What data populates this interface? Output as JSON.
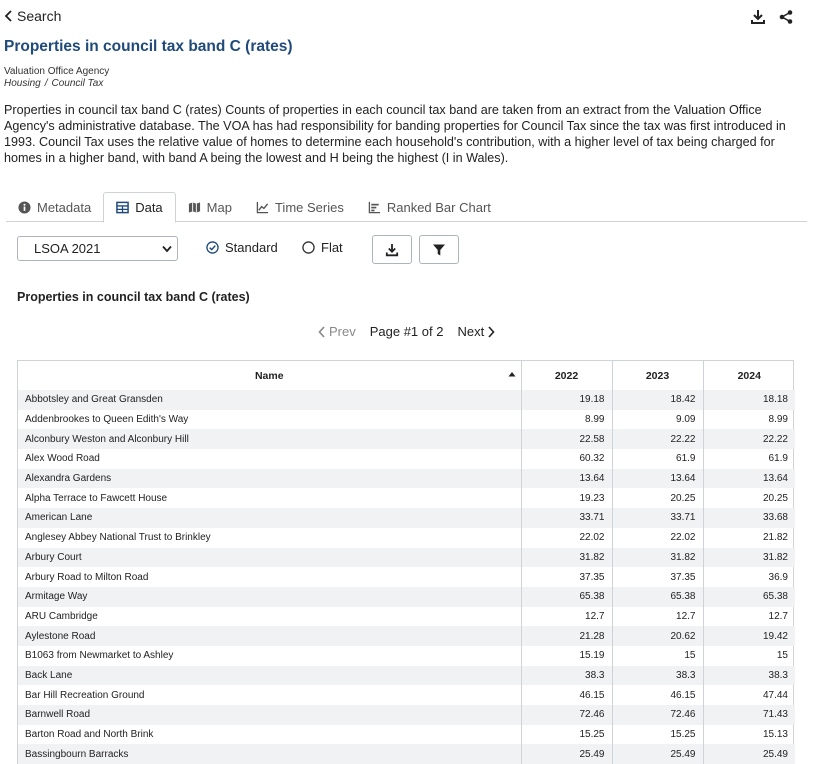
{
  "header": {
    "back_label": "Search",
    "title": "Properties in council tax band C (rates)",
    "publisher": "Valuation Office Agency",
    "breadcrumbs": [
      "Housing",
      "Council Tax"
    ],
    "description": "Properties in council tax band C (rates) Counts of properties in each council tax band are taken from an extract from the Valuation Office Agency's administrative database. The VOA has had responsibility for banding properties for Council Tax since the tax was first introduced in 1993. Council Tax uses the relative value of homes to determine each household's contribution, with a higher level of tax being charged for homes in a higher band, with band A being the lowest and H being the highest (I in Wales)."
  },
  "tabs": [
    {
      "label": "Metadata",
      "icon": "info-icon"
    },
    {
      "label": "Data",
      "icon": "table-icon",
      "active": true
    },
    {
      "label": "Map",
      "icon": "map-icon"
    },
    {
      "label": "Time Series",
      "icon": "line-chart-icon"
    },
    {
      "label": "Ranked Bar Chart",
      "icon": "bar-chart-icon"
    }
  ],
  "controls": {
    "geography_selected": "LSOA 2021",
    "radio_standard": "Standard",
    "radio_flat": "Flat",
    "selected_mode": "Standard"
  },
  "table_title": "Properties in council tax band C (rates)",
  "pager": {
    "prev": "Prev",
    "page_text": "Page #1 of 2",
    "next": "Next"
  },
  "table": {
    "columns": [
      "Name",
      "2022",
      "2023",
      "2024"
    ],
    "rows": [
      [
        "Abbotsley and Great Gransden",
        "19.18",
        "18.42",
        "18.18"
      ],
      [
        "Addenbrookes to Queen Edith's Way",
        "8.99",
        "9.09",
        "8.99"
      ],
      [
        "Alconbury Weston and Alconbury Hill",
        "22.58",
        "22.22",
        "22.22"
      ],
      [
        "Alex Wood Road",
        "60.32",
        "61.9",
        "61.9"
      ],
      [
        "Alexandra Gardens",
        "13.64",
        "13.64",
        "13.64"
      ],
      [
        "Alpha Terrace to Fawcett House",
        "19.23",
        "20.25",
        "20.25"
      ],
      [
        "American Lane",
        "33.71",
        "33.71",
        "33.68"
      ],
      [
        "Anglesey Abbey National Trust to Brinkley",
        "22.02",
        "22.02",
        "21.82"
      ],
      [
        "Arbury Court",
        "31.82",
        "31.82",
        "31.82"
      ],
      [
        "Arbury Road to Milton Road",
        "37.35",
        "37.35",
        "36.9"
      ],
      [
        "Armitage Way",
        "65.38",
        "65.38",
        "65.38"
      ],
      [
        "ARU Cambridge",
        "12.7",
        "12.7",
        "12.7"
      ],
      [
        "Aylestone Road",
        "21.28",
        "20.62",
        "19.42"
      ],
      [
        "B1063 from Newmarket to Ashley",
        "15.19",
        "15",
        "15"
      ],
      [
        "Back Lane",
        "38.3",
        "38.3",
        "38.3"
      ],
      [
        "Bar Hill Recreation Ground",
        "46.15",
        "46.15",
        "47.44"
      ],
      [
        "Barnwell Road",
        "72.46",
        "72.46",
        "71.43"
      ],
      [
        "Barton Road and North Brink",
        "15.25",
        "15.25",
        "15.13"
      ],
      [
        "Bassingbourn Barracks",
        "25.49",
        "25.49",
        "25.49"
      ]
    ]
  }
}
